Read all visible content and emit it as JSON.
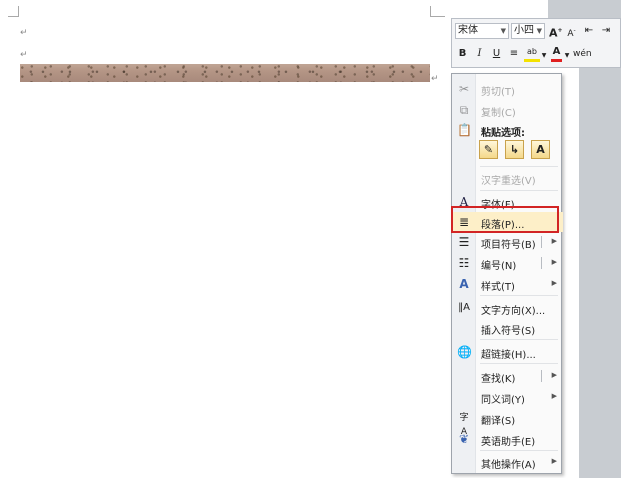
{
  "mini_toolbar": {
    "font_name": "宋体",
    "font_size": "小四",
    "row1_buttons": [
      "A",
      "A",
      "⁝☰"
    ],
    "row2_buttons": [
      "B",
      "I",
      "U",
      "≡",
      "ab",
      "A",
      "wen"
    ]
  },
  "context_menu": {
    "items": [
      {
        "label": "剪切(T)",
        "icon": "scissors-icon",
        "disabled": true
      },
      {
        "label": "复制(C)",
        "icon": "copy-icon",
        "disabled": true
      },
      {
        "label": "粘贴选项:",
        "icon": "clipboard-icon",
        "disabled": false
      },
      {
        "label": "汉字重选(V)",
        "icon": "",
        "disabled": true
      },
      {
        "label": "字体(F)...",
        "icon": "font-icon",
        "disabled": false
      },
      {
        "label": "段落(P)...",
        "icon": "paragraph-icon",
        "disabled": false,
        "highlighted": true
      },
      {
        "label": "项目符号(B)",
        "icon": "bullets-icon",
        "disabled": false
      },
      {
        "label": "编号(N)",
        "icon": "numbering-icon",
        "disabled": false
      },
      {
        "label": "样式(T)",
        "icon": "styles-icon",
        "disabled": false
      },
      {
        "label": "文字方向(X)...",
        "icon": "text-direction-icon",
        "disabled": false
      },
      {
        "label": "插入符号(S)",
        "icon": "",
        "disabled": false
      },
      {
        "label": "超链接(H)...",
        "icon": "hyperlink-icon",
        "disabled": false
      },
      {
        "label": "查找(K)",
        "icon": "",
        "disabled": false
      },
      {
        "label": "同义词(Y)",
        "icon": "",
        "disabled": false
      },
      {
        "label": "翻译(S)",
        "icon": "translate-icon",
        "disabled": false
      },
      {
        "label": "英语助手(E)",
        "icon": "english-assistant-icon",
        "disabled": false
      },
      {
        "label": "其他操作(A)",
        "icon": "",
        "disabled": false
      }
    ],
    "paste_options": [
      "keep-source-formatting-icon",
      "merge-formatting-icon",
      "keep-text-only-icon"
    ],
    "paste_text_only_glyph": "A"
  },
  "colors": {
    "highlight_border": "#d22424",
    "menu_bg": "#fafafa",
    "hover_bg": "#fdefc8"
  }
}
